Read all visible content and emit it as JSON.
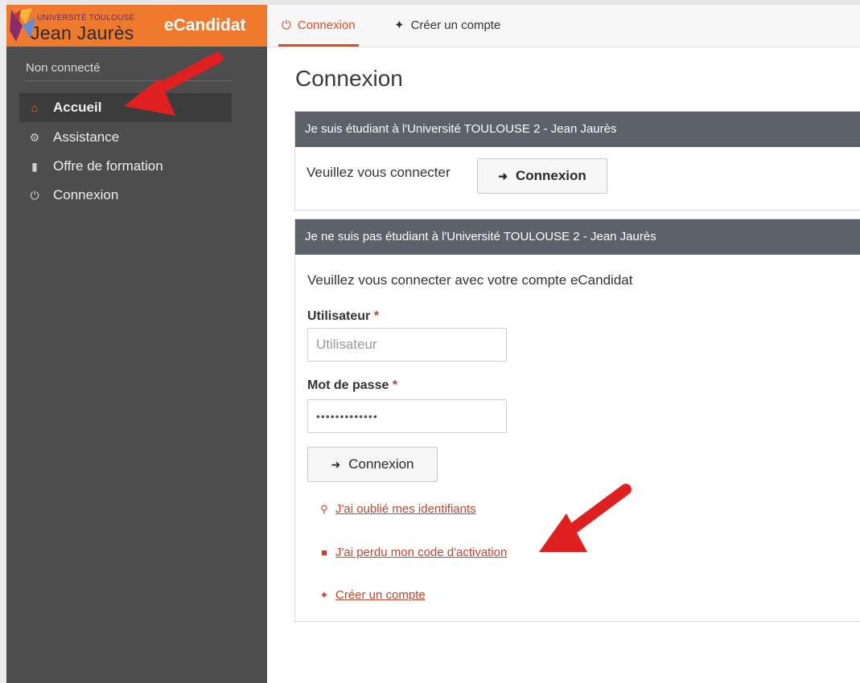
{
  "brand": {
    "university_line": "UNIVERSITÉ TOULOUSE",
    "university_name": "Jean Jaurès",
    "app_name": "eCandidat",
    "accent_color": "#ef7a2e"
  },
  "sidebar": {
    "status": "Non connecté",
    "items": [
      {
        "label": "Accueil",
        "icon": "home-icon"
      },
      {
        "label": "Assistance",
        "icon": "support-icon"
      },
      {
        "label": "Offre de formation",
        "icon": "bookmark-icon"
      },
      {
        "label": "Connexion",
        "icon": "power-icon"
      }
    ]
  },
  "tabs": [
    {
      "label": "Connexion",
      "icon": "power-icon",
      "active": true
    },
    {
      "label": "Créer un compte",
      "icon": "magic-wand-icon",
      "active": false
    }
  ],
  "main": {
    "title": "Connexion",
    "panel_student": {
      "header": "Je suis étudiant à l'Université TOULOUSE 2 - Jean Jaurès",
      "text": "Veuillez vous connecter",
      "button": "Connexion"
    },
    "panel_other": {
      "header": "Je ne suis pas étudiant à l'Université TOULOUSE 2 - Jean Jaurès",
      "text": "Veuillez vous connecter avec votre compte eCandidat",
      "user_label": "Utilisateur",
      "user_placeholder": "Utilisateur",
      "password_label": "Mot de passe",
      "password_value": "•••••••••••••",
      "required_mark": "*",
      "button": "Connexion",
      "links": [
        {
          "label": "J'ai oublié mes identifiants",
          "icon": "key-icon"
        },
        {
          "label": "J'ai perdu mon code d'activation",
          "icon": "lock-icon"
        },
        {
          "label": "Créer un compte",
          "icon": "magic-wand-icon"
        }
      ]
    }
  },
  "colors": {
    "sidebar_bg": "#4d4d4d",
    "panel_header_bg": "#5d6169",
    "link_color": "#c2452a",
    "annotation_arrow": "#e02020"
  }
}
